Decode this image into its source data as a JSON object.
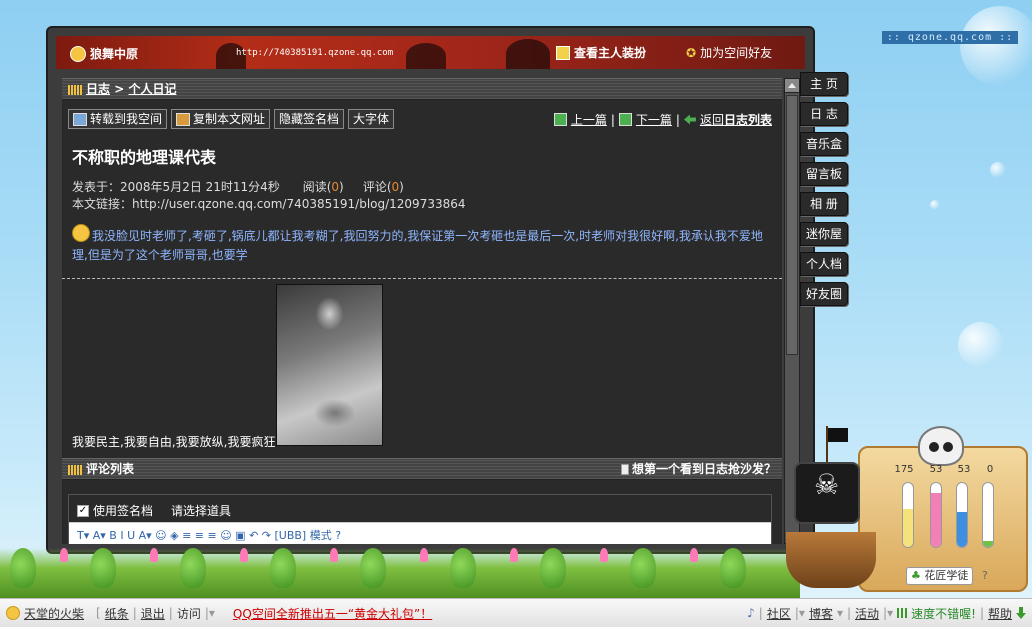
{
  "site_url_badge": ":: qzone.qq.com ::",
  "banner": {
    "space_name": "狼舞中原",
    "url": "http://740385191.qzone.qq.com",
    "view_owner_outfit": "查看主人装扮",
    "add_friend": "加为空间好友"
  },
  "breadcrumb": {
    "blog": "日志",
    "sep": ">",
    "personal_blog": "个人日记"
  },
  "toolbar": {
    "repost": "转载到我空间",
    "copy_url": "复制本文网址",
    "hide_sig": "隐藏签名档",
    "large_font": "大字体"
  },
  "article_nav": {
    "prev": "上一篇",
    "sep": "|",
    "next": "下一篇",
    "back": "返回",
    "back_bold": "日志列表"
  },
  "article": {
    "title": "不称职的地理课代表",
    "posted_label": "发表于：",
    "posted_time": "2008年5月2日  21时11分4秒",
    "read_label": "阅读(",
    "read_count": "0",
    "comment_label": "评论(",
    "comment_count": "0",
    "close_paren": ")",
    "link_label": "本文链接：",
    "link_url": "http://user.qzone.qq.com/740385191/blog/1209733864",
    "body": "我没脸见时老师了,考砸了,锅底儿都让我考糊了,我回努力的,我保证第一次考砸也是最后一次,时老师对我很好啊,我承认我不爱地理,但是为了这个老师哥哥,也要学",
    "caption": "我要民主,我要自由,我要放纵,我要疯狂"
  },
  "comments": {
    "header": "评论列表",
    "sofa": "想第一个看到日志抢沙发？",
    "use_sig": "使用签名档",
    "choose_tool": "请选择道具",
    "editor_tools": "T▾  A▾  B  I  U  A▾  ☺  ◈   ≡  ≡  ≡   ☺  ▣   ↶  ↷   [UBB] 模式   ?"
  },
  "right_menu": [
    "主 页",
    "日 志",
    "音乐盒",
    "留言板",
    "相 册",
    "迷你屋",
    "个人档",
    "好友圈"
  ],
  "pet_panel": {
    "values": [
      "175",
      "53",
      "53",
      "0"
    ],
    "button": "花匠学徒",
    "help": "?"
  },
  "bottom_bar": {
    "user": "天堂的火柴",
    "notes": "纸条",
    "logout": "退出",
    "visit": "访问",
    "promo": "QQ空间全新推出五一“黄金大礼包”！",
    "community": "社区",
    "blog": "博客",
    "activity": "活动",
    "speed": "速度不错喔!",
    "help": "帮助"
  },
  "colors": {
    "banner": "#b32d17",
    "content_bg": "#2a2a2a",
    "link_blue": "#8fb6ff",
    "count_orange": "#e88a2a",
    "promo_red": "#cc0000"
  }
}
